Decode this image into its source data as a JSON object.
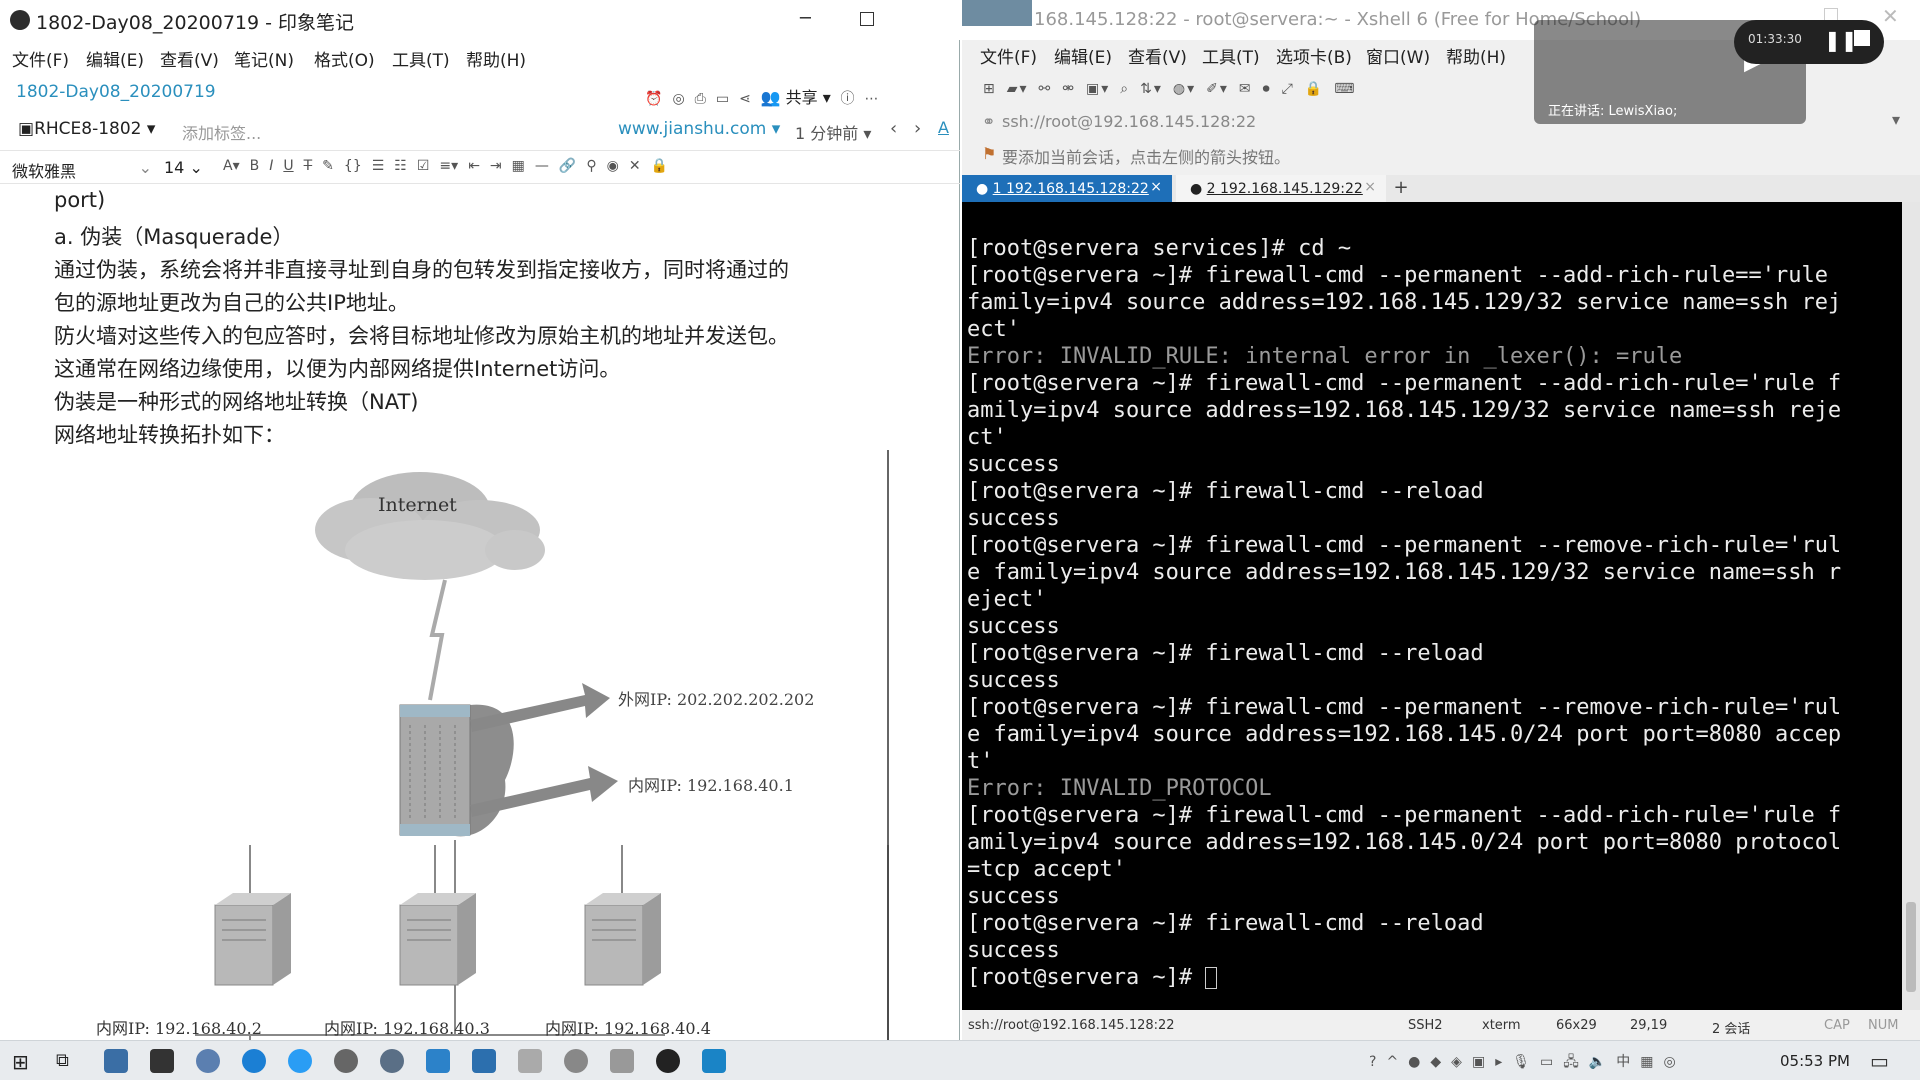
{
  "evernote": {
    "window_title": "1802-Day08_20200719 - 印象笔记",
    "menu": [
      "文件(F)",
      "编辑(E)",
      "查看(V)",
      "笔记(N)",
      "格式(O)",
      "工具(T)",
      "帮助(H)"
    ],
    "note_title": "1802-Day08_20200719",
    "share_label": "共享",
    "notebook": "RHCE8-1802",
    "add_tag_placeholder": "添加标签...",
    "source_url": "www.jianshu.com",
    "time_ago": "1 分钟前",
    "font_name": "微软雅黑",
    "font_size": "14",
    "lines": [
      "port)",
      "a. 伪装（Masquerade）",
      "通过伪装，系统会将并非直接寻址到自身的包转发到指定接收方，同时将通过的",
      "包的源地址更改为自己的公共IP地址。",
      "防火墙对这些传入的包应答时，会将目标地址修改为原始主机的地址并发送包。",
      "这通常在网络边缘使用，以便为内部网络提供Internet访问。",
      "伪装是一种形式的网络地址转换（NAT)",
      "网络地址转换拓扑如下："
    ],
    "diagram": {
      "cloud_label": "Internet",
      "outer_ip": "外网IP: 202.202.202.202",
      "inner_ip": "内网IP: 192.168.40.1",
      "hosts": [
        "内网IP: 192.168.40.2",
        "内网IP: 192.168.40.3",
        "内网IP: 192.168.40.4"
      ]
    }
  },
  "xshell": {
    "window_title": "168.145.128:22 - root@servera:~ - Xshell 6 (Free for Home/School)",
    "menu": [
      "文件(F)",
      "编辑(E)",
      "查看(V)",
      "工具(T)",
      "选项卡(B)",
      "窗口(W)",
      "帮助(H)"
    ],
    "address": "ssh://root@192.168.145.128:22",
    "hint": "要添加当前会话，点击左侧的箭头按钮。",
    "tabs": [
      "1 192.168.145.128:22",
      "2 192.168.145.129:22"
    ],
    "terminal_lines": [
      {
        "text": "[root@servera services]# cd ~",
        "err": false
      },
      {
        "text": "[root@servera ~]# firewall-cmd --permanent --add-rich-rule=='rule",
        "err": false
      },
      {
        "text": "family=ipv4 source address=192.168.145.129/32 service name=ssh rej",
        "err": false
      },
      {
        "text": "ect'",
        "err": false
      },
      {
        "text": "Error: INVALID_RULE: internal error in _lexer(): =rule",
        "err": true
      },
      {
        "text": "[root@servera ~]# firewall-cmd --permanent --add-rich-rule='rule f",
        "err": false
      },
      {
        "text": "amily=ipv4 source address=192.168.145.129/32 service name=ssh reje",
        "err": false
      },
      {
        "text": "ct'",
        "err": false
      },
      {
        "text": "success",
        "err": false
      },
      {
        "text": "[root@servera ~]# firewall-cmd --reload",
        "err": false
      },
      {
        "text": "success",
        "err": false
      },
      {
        "text": "[root@servera ~]# firewall-cmd --permanent --remove-rich-rule='rul",
        "err": false
      },
      {
        "text": "e family=ipv4 source address=192.168.145.129/32 service name=ssh r",
        "err": false
      },
      {
        "text": "eject'",
        "err": false
      },
      {
        "text": "success",
        "err": false
      },
      {
        "text": "[root@servera ~]# firewall-cmd --reload",
        "err": false
      },
      {
        "text": "success",
        "err": false
      },
      {
        "text": "[root@servera ~]# firewall-cmd --permanent --remove-rich-rule='rul",
        "err": false
      },
      {
        "text": "e family=ipv4 source address=192.168.145.0/24 port port=8080 accep",
        "err": false
      },
      {
        "text": "t'",
        "err": false
      },
      {
        "text": "Error: INVALID_PROTOCOL",
        "err": true
      },
      {
        "text": "[root@servera ~]# firewall-cmd --permanent --add-rich-rule='rule f",
        "err": false
      },
      {
        "text": "amily=ipv4 source address=192.168.145.0/24 port port=8080 protocol",
        "err": false
      },
      {
        "text": "=tcp accept'",
        "err": false
      },
      {
        "text": "success",
        "err": false
      },
      {
        "text": "[root@servera ~]# firewall-cmd --reload",
        "err": false
      },
      {
        "text": "success",
        "err": false
      },
      {
        "text": "[root@servera ~]# ",
        "err": false
      }
    ],
    "status": {
      "path": "ssh://root@192.168.145.128:22",
      "proto": "SSH2",
      "term": "xterm",
      "size": "66x29",
      "cursor": "29,19",
      "sessions": "2 会话",
      "caps": "CAP",
      "num": "NUM"
    }
  },
  "overlay": {
    "speaking": "正在讲话: LewisXiao;",
    "timer": "01:33:30"
  },
  "taskbar": {
    "time": "05:53 PM"
  }
}
